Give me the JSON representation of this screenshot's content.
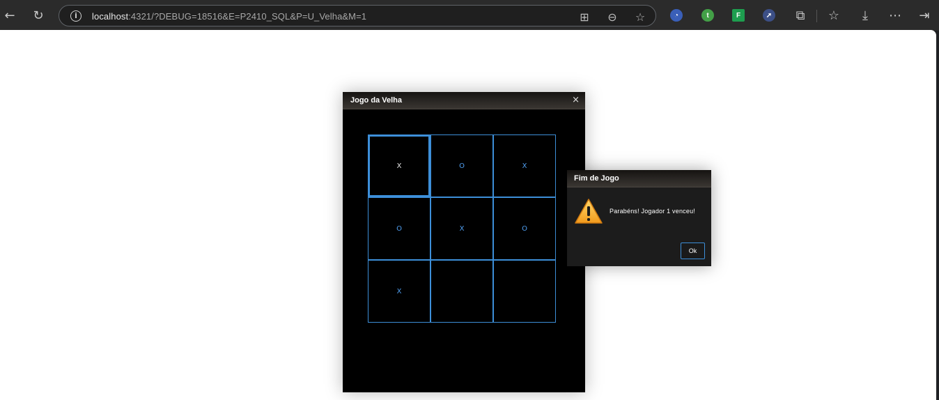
{
  "browser": {
    "url_host": "localhost",
    "url_rest": ":4321/?DEBUG=18516&E=P2410_SQL&P=U_Velha&M=1",
    "back_icon": "back-arrow-icon",
    "reload_icon": "reload-icon",
    "extensions": [
      {
        "name": "extension-blue-icon",
        "glyph": "◔",
        "color": "#6f8fd8"
      },
      {
        "name": "extension-green-icon",
        "glyph": "t",
        "color": "#5cb85c"
      },
      {
        "name": "extension-f-icon",
        "glyph": "F",
        "color": "#1e9e4f"
      },
      {
        "name": "extension-rocket-icon",
        "glyph": "➚",
        "color": "#7a8cc4"
      }
    ]
  },
  "game_window": {
    "title": "Jogo da Velha",
    "close_glyph": "×",
    "cells": [
      "X",
      "O",
      "X",
      "O",
      "X",
      "O",
      "X",
      "",
      ""
    ]
  },
  "dialog": {
    "title": "Fim de Jogo",
    "message": "Parabéns! Jogador 1 venceu!",
    "ok_label": "Ok"
  }
}
